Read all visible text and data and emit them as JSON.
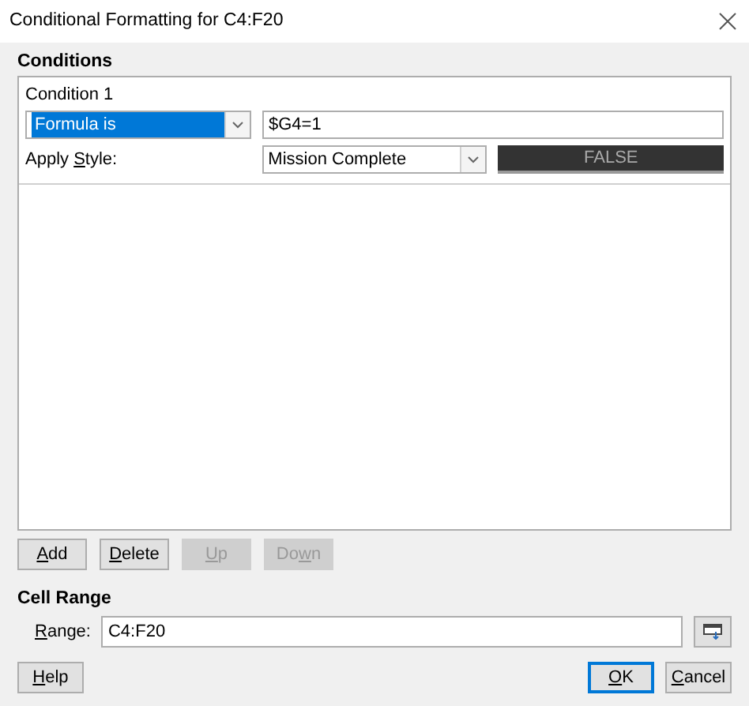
{
  "window": {
    "title": "Conditional Formatting for C4:F20"
  },
  "conditions": {
    "heading": "Conditions",
    "entries": [
      {
        "title": "Condition 1",
        "type": {
          "value": "Formula is",
          "highlighted": true
        },
        "formula": "$G4=1",
        "apply_style_label": [
          {
            "text": "Apply ",
            "underlined": false
          },
          {
            "text": "S",
            "underlined": true
          },
          {
            "text": "tyle:",
            "underlined": false
          }
        ],
        "style": "Mission Complete",
        "preview": "FALSE"
      }
    ]
  },
  "list_buttons": [
    {
      "label": [
        {
          "text": "A",
          "underlined": true
        },
        {
          "text": "dd",
          "underlined": false
        }
      ],
      "disabled": false
    },
    {
      "label": [
        {
          "text": "D",
          "underlined": true
        },
        {
          "text": "elete",
          "underlined": false
        }
      ],
      "disabled": false
    },
    {
      "label": [
        {
          "text": "U",
          "underlined": true
        },
        {
          "text": "p",
          "underlined": false
        }
      ],
      "disabled": true
    },
    {
      "label": [
        {
          "text": "Do",
          "underlined": false
        },
        {
          "text": "w",
          "underlined": true
        },
        {
          "text": "n",
          "underlined": false
        }
      ],
      "disabled": true
    }
  ],
  "cell_range": {
    "heading": "Cell Range",
    "label": [
      {
        "text": "R",
        "underlined": true
      },
      {
        "text": "ange:",
        "underlined": false
      }
    ],
    "value": "C4:F20"
  },
  "footer": {
    "left": [
      {
        "label": [
          {
            "text": "H",
            "underlined": true
          },
          {
            "text": "elp",
            "underlined": false
          }
        ],
        "default": false
      }
    ],
    "right": [
      {
        "label": [
          {
            "text": "O",
            "underlined": true
          },
          {
            "text": "K",
            "underlined": false
          }
        ],
        "default": true
      },
      {
        "label": [
          {
            "text": "C",
            "underlined": true
          },
          {
            "text": "ancel",
            "underlined": false
          }
        ],
        "default": false
      }
    ]
  }
}
